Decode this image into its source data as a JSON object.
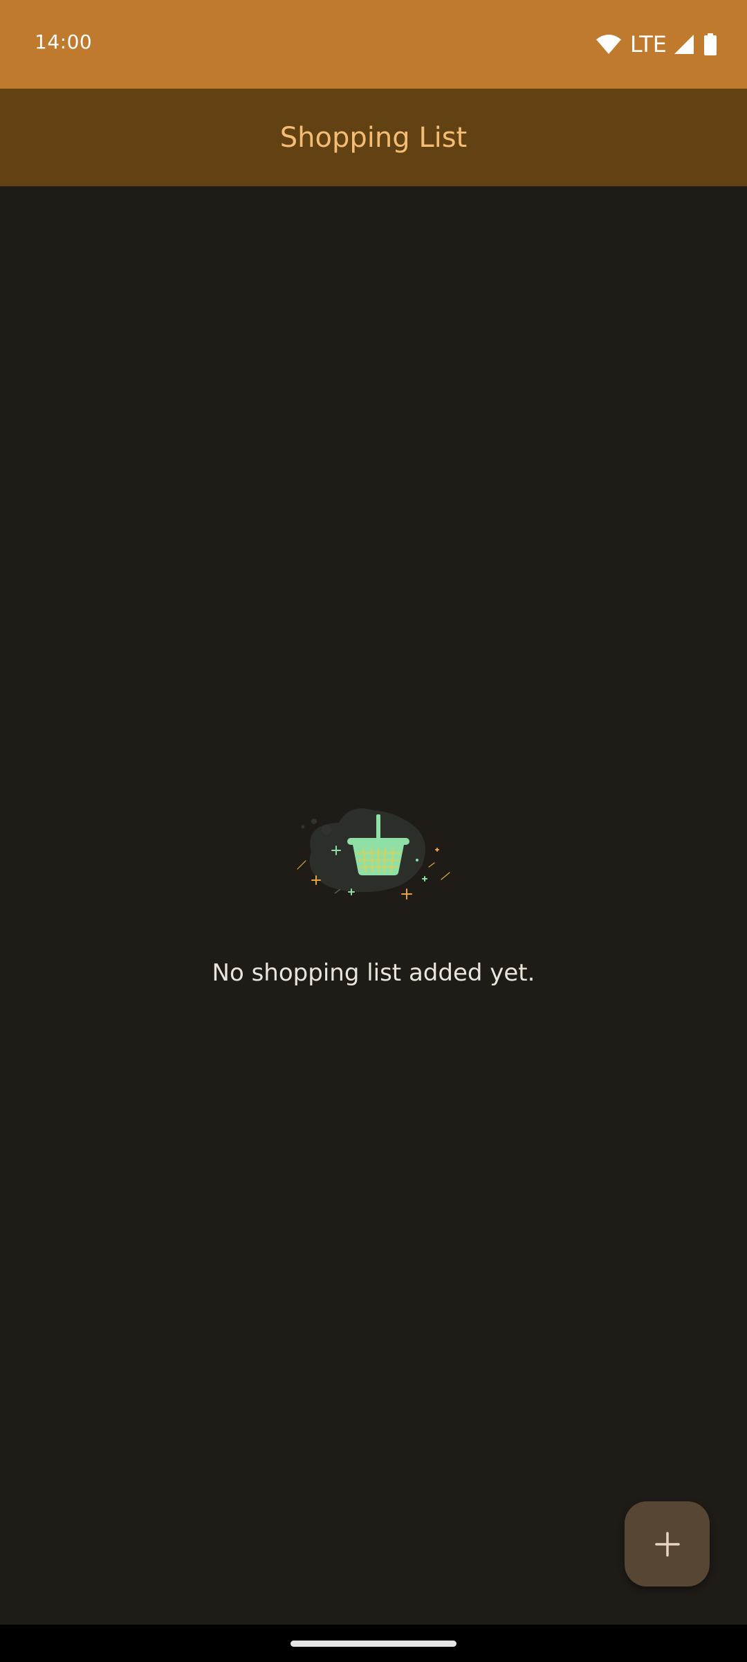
{
  "status_bar": {
    "time": "14:00",
    "network_label": "LTE",
    "icons": [
      "wifi-icon",
      "cell-signal-icon",
      "battery-icon"
    ]
  },
  "app_bar": {
    "title": "Shopping List"
  },
  "empty_state": {
    "illustration": "shopping-basket-icon",
    "message": "No shopping list added yet."
  },
  "fab": {
    "icon": "plus-icon"
  },
  "colors": {
    "status_bar": "#c07a2e",
    "app_bar": "#624212",
    "title_text": "#f4bc74",
    "background": "#1f1c18",
    "fab": "#564633",
    "basket": "#8fe0a6"
  }
}
